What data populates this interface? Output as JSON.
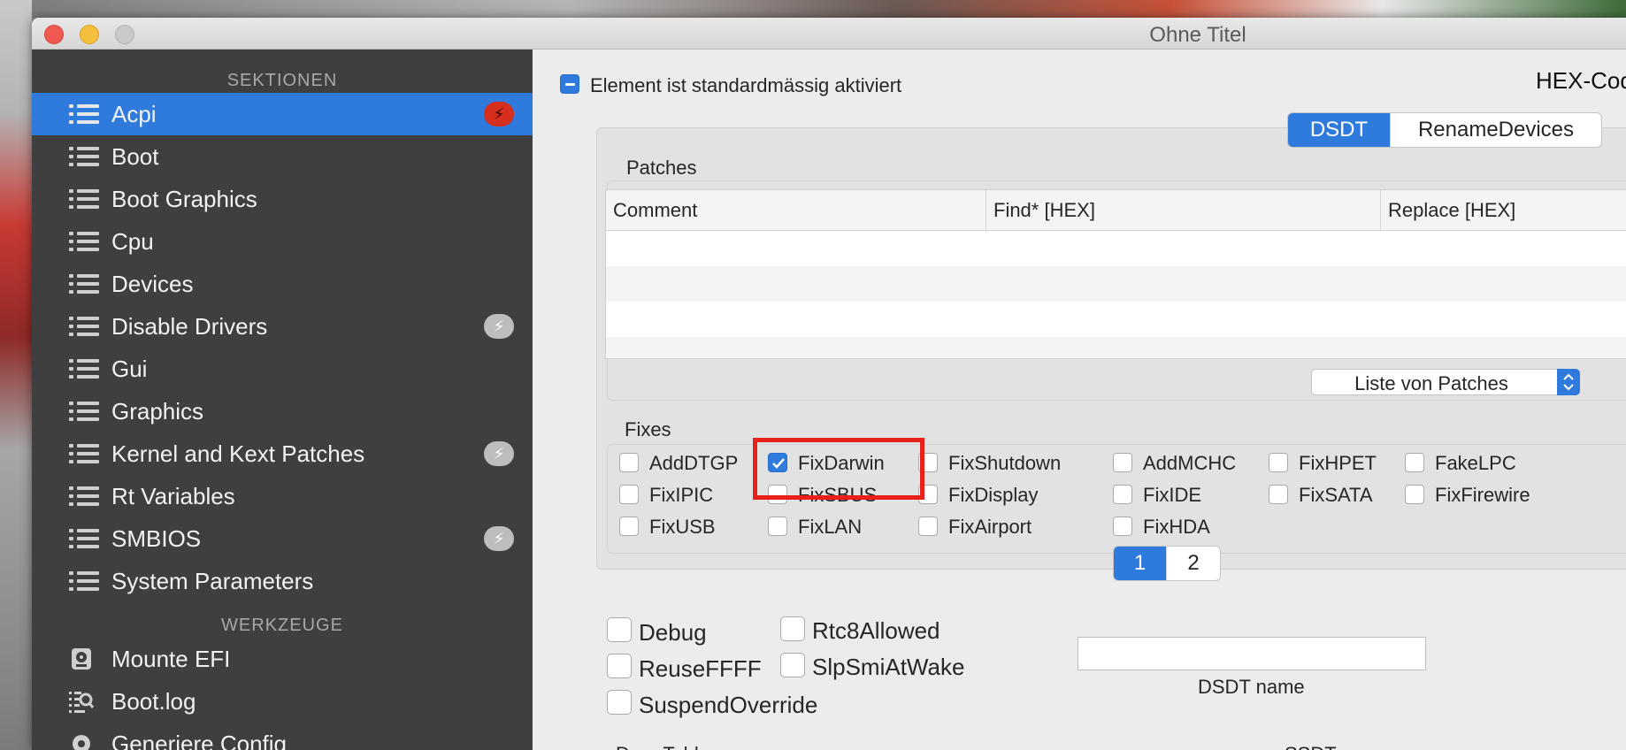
{
  "window": {
    "title": "Ohne Titel"
  },
  "sidebar": {
    "sections_header": "SEKTIONEN",
    "items": [
      {
        "label": "Acpi",
        "selected": true,
        "badge": "⚡",
        "badge_color": "#d72f1e"
      },
      {
        "label": "Boot"
      },
      {
        "label": "Boot Graphics"
      },
      {
        "label": "Cpu"
      },
      {
        "label": "Devices"
      },
      {
        "label": "Disable Drivers",
        "badge": "⚡"
      },
      {
        "label": "Gui"
      },
      {
        "label": "Graphics"
      },
      {
        "label": "Kernel and Kext Patches",
        "badge": "⚡"
      },
      {
        "label": "Rt Variables"
      },
      {
        "label": "SMBIOS",
        "badge": "⚡"
      },
      {
        "label": "System Parameters"
      }
    ],
    "tools_header": "WERKZEUGE",
    "tools": [
      {
        "label": "Mounte EFI",
        "icon": "disk-icon"
      },
      {
        "label": "Boot.log",
        "icon": "log-search-icon"
      },
      {
        "label": "Generiere Config",
        "icon": "gear-icon"
      }
    ]
  },
  "main": {
    "enabled_by_default_label": "Element ist standardmässig aktiviert",
    "hex_code_label": "HEX-Code w",
    "tabs": [
      {
        "label": "DSDT",
        "active": true
      },
      {
        "label": "RenameDevices",
        "active": false
      }
    ],
    "patches": {
      "title": "Patches",
      "columns": [
        "Comment",
        "Find* [HEX]",
        "Replace [HEX]"
      ],
      "popup_label": "Liste von Patches"
    },
    "fixes": {
      "title": "Fixes",
      "checkboxes": [
        {
          "label": "AddDTGP",
          "checked": false
        },
        {
          "label": "FixDarwin",
          "checked": true
        },
        {
          "label": "FixShutdown",
          "checked": false
        },
        {
          "label": "AddMCHC",
          "checked": false
        },
        {
          "label": "FixHPET",
          "checked": false
        },
        {
          "label": "FakeLPC",
          "checked": false
        },
        {
          "label": "FixIPIC",
          "checked": false
        },
        {
          "label": "FixSBUS",
          "checked": false
        },
        {
          "label": "FixDisplay",
          "checked": false
        },
        {
          "label": "FixIDE",
          "checked": false
        },
        {
          "label": "FixSATA",
          "checked": false
        },
        {
          "label": "FixFirewire",
          "checked": false
        },
        {
          "label": "FixUSB",
          "checked": false
        },
        {
          "label": "FixLAN",
          "checked": false
        },
        {
          "label": "FixAirport",
          "checked": false
        },
        {
          "label": "FixHDA",
          "checked": false
        }
      ],
      "pages": [
        {
          "label": "1",
          "active": true
        },
        {
          "label": "2",
          "active": false
        }
      ]
    },
    "options": [
      {
        "label": "Debug",
        "checked": false
      },
      {
        "label": "Rtc8Allowed",
        "checked": false
      },
      {
        "label": "ReuseFFFF",
        "checked": false
      },
      {
        "label": "SlpSmiAtWake",
        "checked": false
      },
      {
        "label": "SuspendOverride",
        "checked": false
      }
    ],
    "dsdt_name": {
      "label": "DSDT name",
      "value": ""
    },
    "drop_tables_label": "Drop Tables",
    "ssdt_label": "SSDT"
  },
  "colors": {
    "accent": "#2f7bdd",
    "sidebar_bg": "#3f3f3f",
    "highlight": "#e8201a"
  }
}
